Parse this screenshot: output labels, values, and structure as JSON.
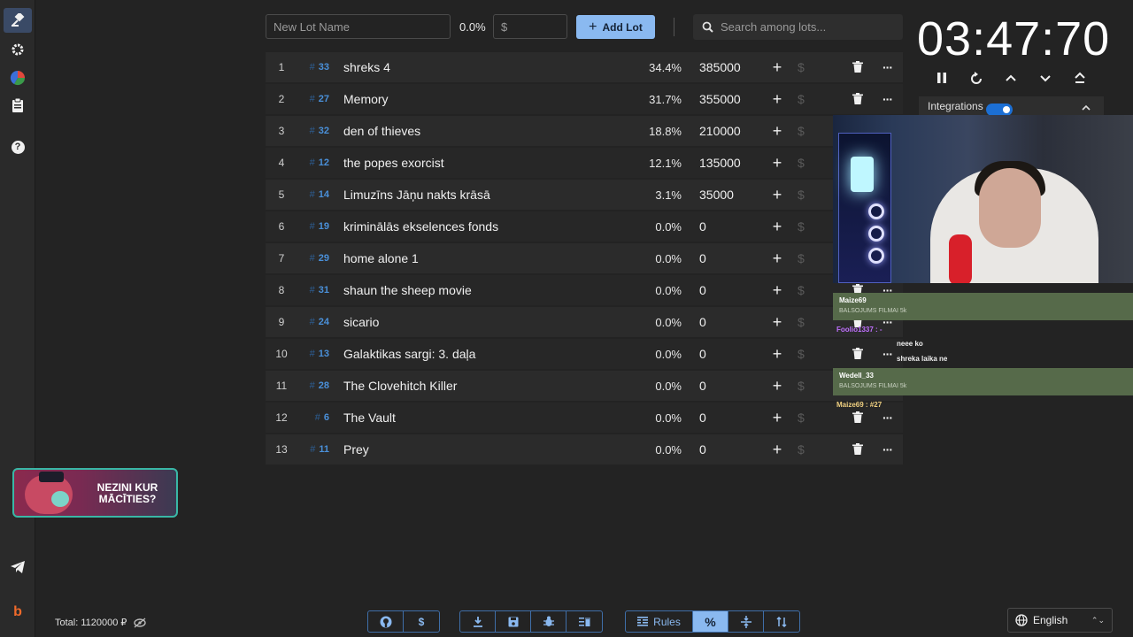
{
  "sidebar": {
    "icons": [
      "gavel-icon",
      "gear-icon",
      "pie-chart-icon",
      "clipboard-icon",
      "help-icon",
      "telegram-icon",
      "boosty-icon"
    ],
    "help_glyph": "?",
    "boosty_glyph": "b"
  },
  "toolbar": {
    "lot_name_placeholder": "New Lot Name",
    "percent": "0.0%",
    "amount_placeholder": "$",
    "add_lot_label": "Add Lot",
    "search_placeholder": "Search among lots..."
  },
  "lots": [
    {
      "index": "1",
      "id": "33",
      "name": "shreks 4",
      "percent": "34.4%",
      "amount": "385000"
    },
    {
      "index": "2",
      "id": "27",
      "name": "Memory",
      "percent": "31.7%",
      "amount": "355000"
    },
    {
      "index": "3",
      "id": "32",
      "name": "den of thieves",
      "percent": "18.8%",
      "amount": "210000"
    },
    {
      "index": "4",
      "id": "12",
      "name": "the popes exorcist",
      "percent": "12.1%",
      "amount": "135000"
    },
    {
      "index": "5",
      "id": "14",
      "name": "Limuzīns Jāņu nakts krāsā",
      "percent": "3.1%",
      "amount": "35000"
    },
    {
      "index": "6",
      "id": "19",
      "name": "kriminālās ekselences fonds",
      "percent": "0.0%",
      "amount": "0"
    },
    {
      "index": "7",
      "id": "29",
      "name": "home alone 1",
      "percent": "0.0%",
      "amount": "0"
    },
    {
      "index": "8",
      "id": "31",
      "name": "shaun the sheep movie",
      "percent": "0.0%",
      "amount": "0"
    },
    {
      "index": "9",
      "id": "24",
      "name": "sicario",
      "percent": "0.0%",
      "amount": "0"
    },
    {
      "index": "10",
      "id": "13",
      "name": "Galaktikas sargi: 3. daļa",
      "percent": "0.0%",
      "amount": "0"
    },
    {
      "index": "11",
      "id": "28",
      "name": "The Clovehitch Killer",
      "percent": "0.0%",
      "amount": "0"
    },
    {
      "index": "12",
      "id": "6",
      "name": "The Vault",
      "percent": "0.0%",
      "amount": "0"
    },
    {
      "index": "13",
      "id": "11",
      "name": "Prey",
      "percent": "0.0%",
      "amount": "0"
    }
  ],
  "timer": {
    "value": "03:47:70"
  },
  "integrations": {
    "label": "Integrations",
    "enabled": true
  },
  "chat": {
    "highlight1_name": "Maize69",
    "highlight1_sub": "BALSOJUMS FILMAI 5k",
    "line1": "Foolio1337 : -",
    "line2": "neee ko",
    "line3": "shreka laika ne",
    "highlight2_name": "Wedell_33",
    "highlight2_sub": "BALSOJUMS FILMAI 5k",
    "line4": "Maize69 : #27"
  },
  "promo": {
    "text": "NEZINI KUR MĀCĪTIES?"
  },
  "footer": {
    "total_label": "Total: 1120000 ₽",
    "group1": [
      "github-icon",
      "dollar-icon"
    ],
    "group2": [
      "download-icon",
      "save-icon",
      "bug-icon",
      "delete-list-icon"
    ],
    "rules_label": "Rules",
    "percent_glyph": "%",
    "language": "English"
  }
}
